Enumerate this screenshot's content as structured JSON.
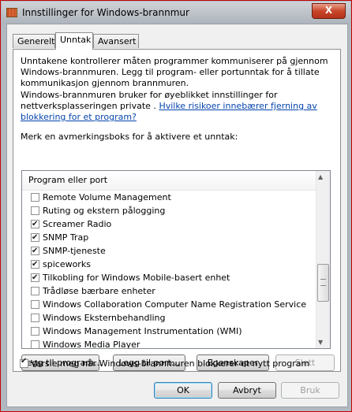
{
  "window": {
    "title": "Innstillinger for Windows-brannmur",
    "close_label": "X"
  },
  "tabs": [
    {
      "label": "Generelt",
      "active": false
    },
    {
      "label": "Unntak",
      "active": true
    },
    {
      "label": "Avansert",
      "active": false
    }
  ],
  "intro": {
    "paragraph1": "Unntakene kontrollerer måten programmer kommuniserer på gjennom Windows-brannmuren. Legg til program- eller portunntak for å tillate kommunikasjon gjennom brannmuren.",
    "paragraph2_prefix": "Windows-brannmuren bruker for øyeblikket innstillinger for nettverksplasseringen private .",
    "paragraph2_link": "Hvilke risikoer innebærer fjerning av blokkering for et program?",
    "list_caption": "Merk en avmerkingsboks for å aktivere et unntak:"
  },
  "exception_list": {
    "header": "Program eller port",
    "items": [
      {
        "label": "Remote Volume Management",
        "checked": false
      },
      {
        "label": "Ruting og ekstern pålogging",
        "checked": false
      },
      {
        "label": "Screamer Radio",
        "checked": true
      },
      {
        "label": "SNMP Trap",
        "checked": true
      },
      {
        "label": "SNMP-tjeneste",
        "checked": true
      },
      {
        "label": "spiceworks",
        "checked": true
      },
      {
        "label": "Tilkobling for Windows Mobile-basert enhet",
        "checked": true
      },
      {
        "label": "Trådløse bærbare enheter",
        "checked": false
      },
      {
        "label": "Windows Collaboration Computer Name Registration Service",
        "checked": false
      },
      {
        "label": "Windows Eksternbehandling",
        "checked": false
      },
      {
        "label": "Windows Management Instrumentation (WMI)",
        "checked": false
      },
      {
        "label": "Windows Media Player",
        "checked": false
      }
    ]
  },
  "list_buttons": {
    "add_program": "Legg til program...",
    "add_port": "Legg til port...",
    "properties": "Egenskaper",
    "delete": "Slett"
  },
  "notify": {
    "label": "Varsle meg når Windows-brannmuren blokkerer et nytt program",
    "checked": true
  },
  "dialog_buttons": {
    "ok": "OK",
    "cancel": "Avbryt",
    "apply": "Bruk"
  }
}
